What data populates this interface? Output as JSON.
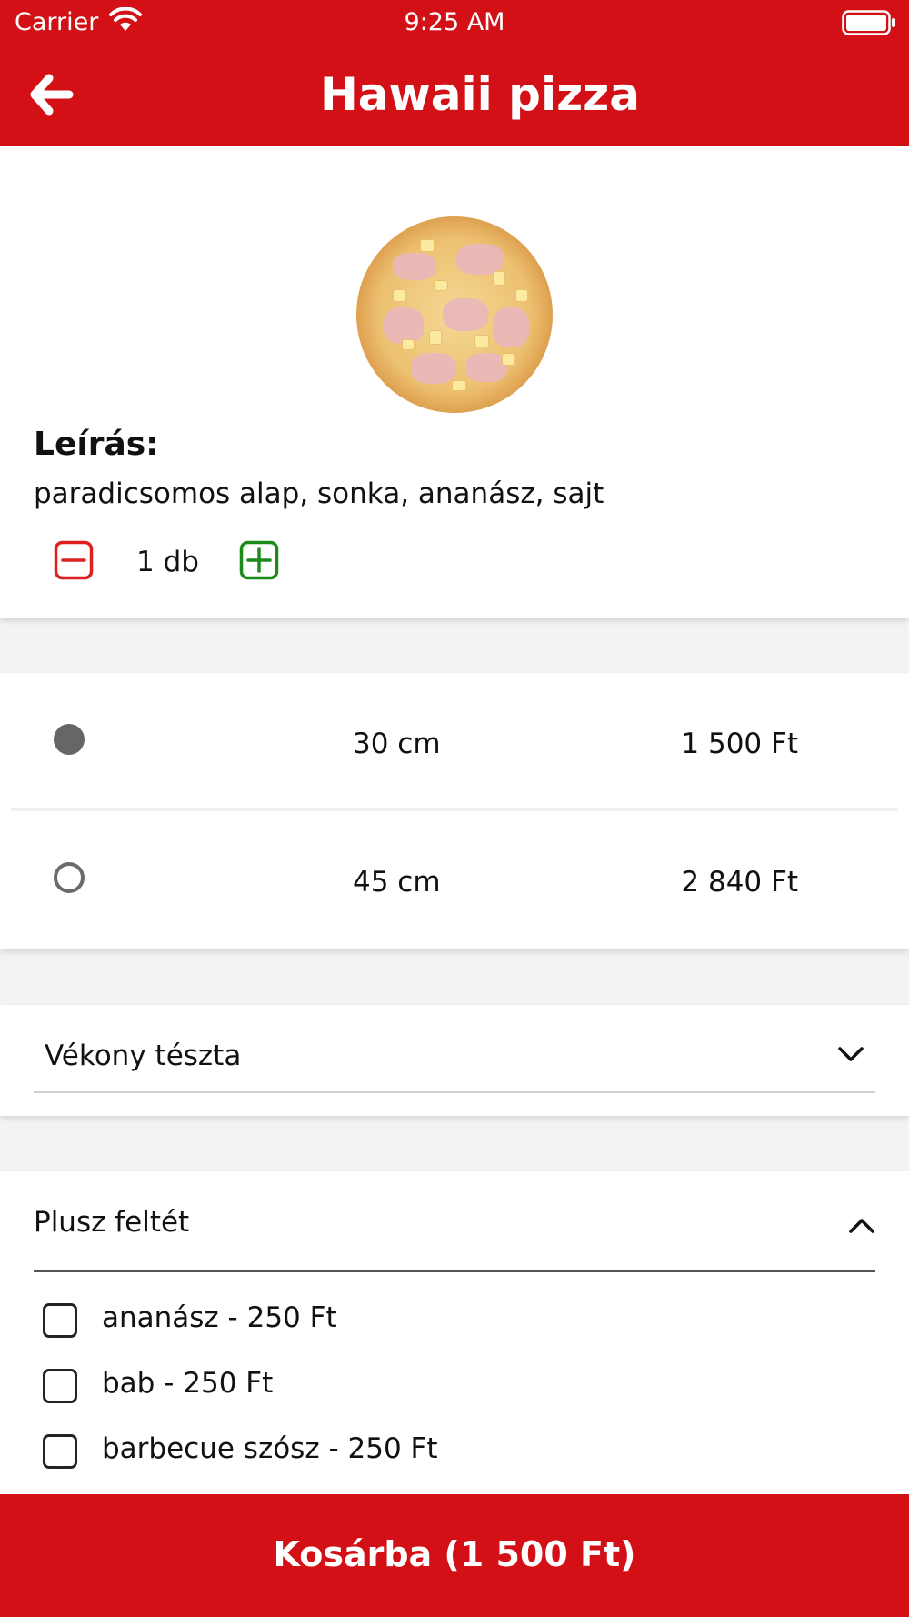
{
  "status_bar": {
    "carrier": "Carrier",
    "time": "9:25 AM"
  },
  "nav": {
    "title": "Hawaii pizza",
    "back_icon": "arrow-left-icon"
  },
  "product": {
    "image_icon": "pizza-image",
    "description_label": "Leírás:",
    "description": "paradicsomos alap, sonka, ananász, sajt",
    "quantity_text": "1 db"
  },
  "sizes": [
    {
      "size": "30 cm",
      "price": "1 500 Ft",
      "selected": true
    },
    {
      "size": "45 cm",
      "price": "2 840 Ft",
      "selected": false
    }
  ],
  "dough": {
    "selected": "Vékony tészta"
  },
  "extras": {
    "title": "Plusz feltét",
    "items": [
      {
        "label": "ananász - 250 Ft",
        "checked": false
      },
      {
        "label": "bab - 250 Ft",
        "checked": false
      },
      {
        "label": "barbecue szósz - 250 Ft",
        "checked": false
      }
    ]
  },
  "cart": {
    "label": "Kosárba (1 500 Ft)"
  },
  "colors": {
    "brand_red": "#d21015",
    "minus_red": "#e02020",
    "plus_green": "#1a8a1a"
  }
}
